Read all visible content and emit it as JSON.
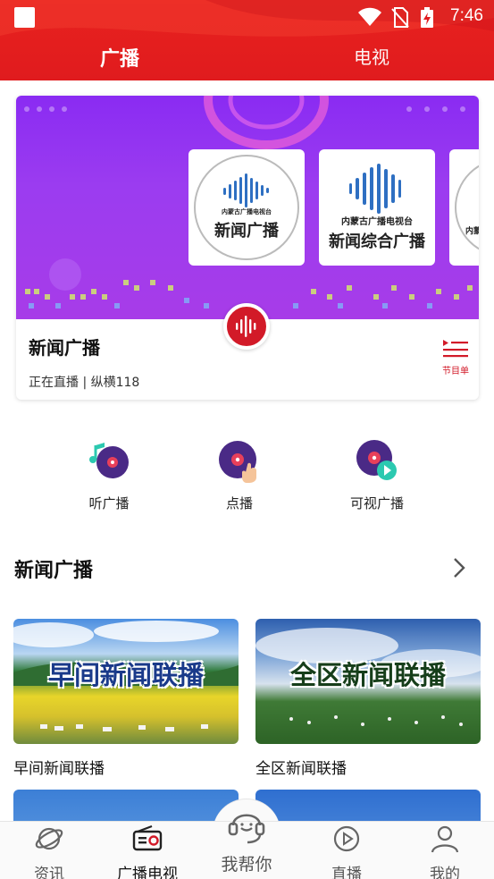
{
  "status_bar": {
    "time": "7:46",
    "icons": [
      "notification-square-icon",
      "wifi-icon",
      "no-sim-icon",
      "battery-charging-icon"
    ]
  },
  "header": {
    "tabs": [
      {
        "label": "广播",
        "active": true
      },
      {
        "label": "电视",
        "active": false
      }
    ],
    "color": "#e21d1f"
  },
  "hero": {
    "station_cards": [
      {
        "org": "内蒙古广播电视台",
        "name": "新闻广播"
      },
      {
        "org": "内蒙古广播电视台",
        "name": "新闻综合广播"
      },
      {
        "org": "内蒙"
      }
    ],
    "title": "新闻广播",
    "subtitle": "正在直播 | 纵横118",
    "schedule_label": "节目单"
  },
  "quick_actions": [
    {
      "label": "听广播",
      "icon": "listen-radio-icon"
    },
    {
      "label": "点播",
      "icon": "on-demand-icon"
    },
    {
      "label": "可视广播",
      "icon": "video-radio-icon"
    }
  ],
  "section": {
    "title": "新闻广播",
    "more_icon": "chevron-right-icon"
  },
  "programs": [
    {
      "overlay": "早间新闻联播",
      "caption": "早间新闻联播"
    },
    {
      "overlay": "全区新闻联播",
      "caption": "全区新闻联播"
    },
    {
      "overlay": "",
      "caption": ""
    },
    {
      "overlay": "",
      "caption": ""
    }
  ],
  "bottom_nav": {
    "items": [
      {
        "label": "资讯",
        "icon": "planet-icon",
        "active": false
      },
      {
        "label": "广播电视",
        "icon": "radio-icon",
        "active": true
      },
      {
        "label": "我帮你",
        "icon": "headset-icon",
        "active": false
      },
      {
        "label": "直播",
        "icon": "play-circle-icon",
        "active": false
      },
      {
        "label": "我的",
        "icon": "user-icon",
        "active": false
      }
    ]
  },
  "colors": {
    "brand_red": "#e21d1f",
    "banner_purple": "#9437f0",
    "accent_red": "#d21a28"
  }
}
